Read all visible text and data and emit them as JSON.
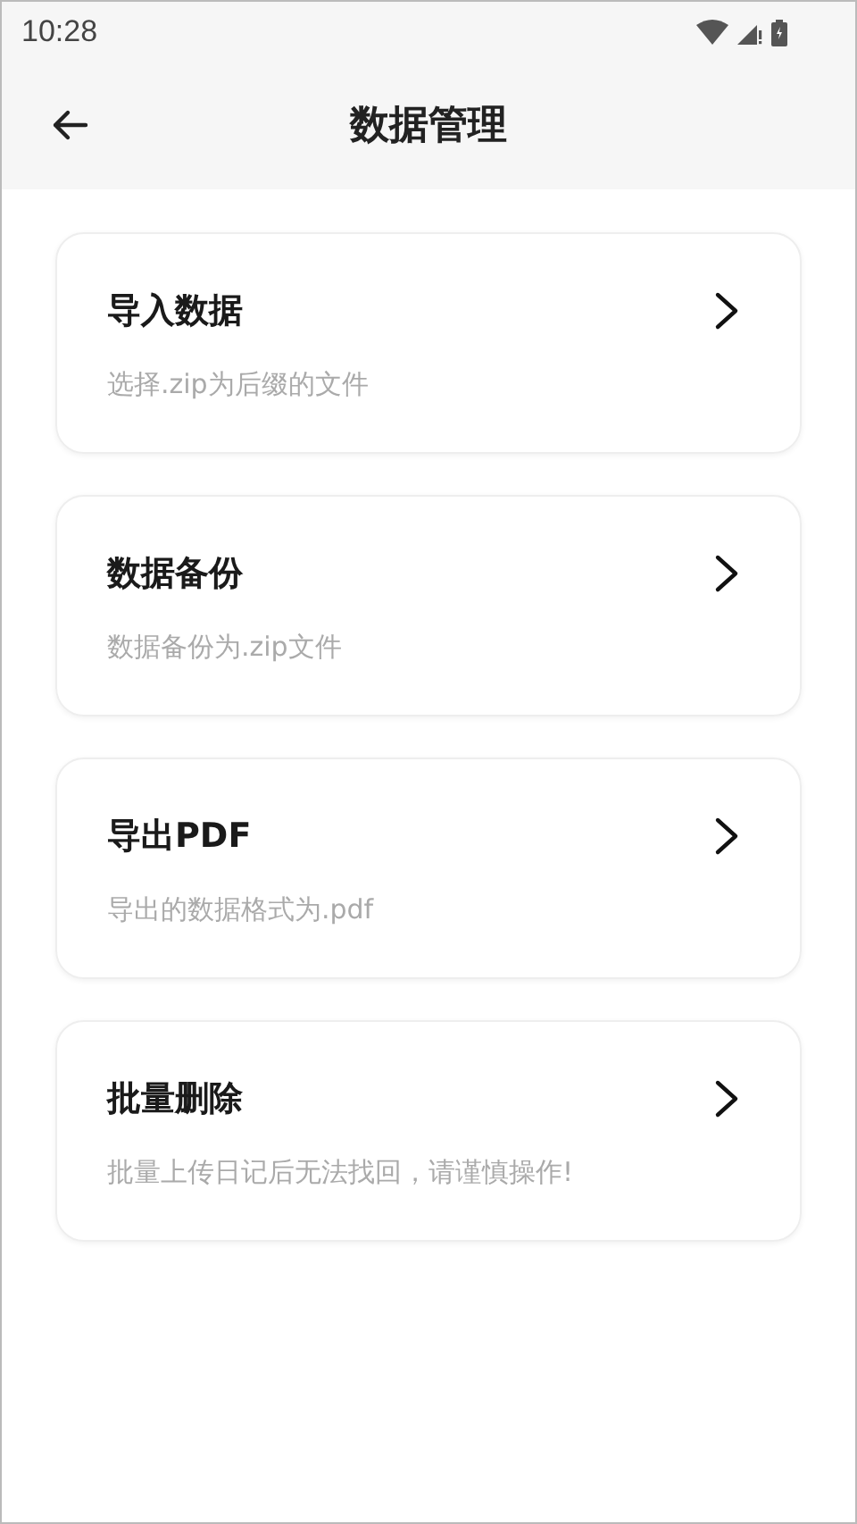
{
  "status_bar": {
    "time": "10:28"
  },
  "app_bar": {
    "title": "数据管理"
  },
  "items": [
    {
      "title": "导入数据",
      "subtitle": "选择.zip为后缀的文件"
    },
    {
      "title": "数据备份",
      "subtitle": "数据备份为.zip文件"
    },
    {
      "title": "导出PDF",
      "subtitle": "导出的数据格式为.pdf"
    },
    {
      "title": "批量删除",
      "subtitle": "批量上传日记后无法找回，请谨慎操作!"
    }
  ]
}
